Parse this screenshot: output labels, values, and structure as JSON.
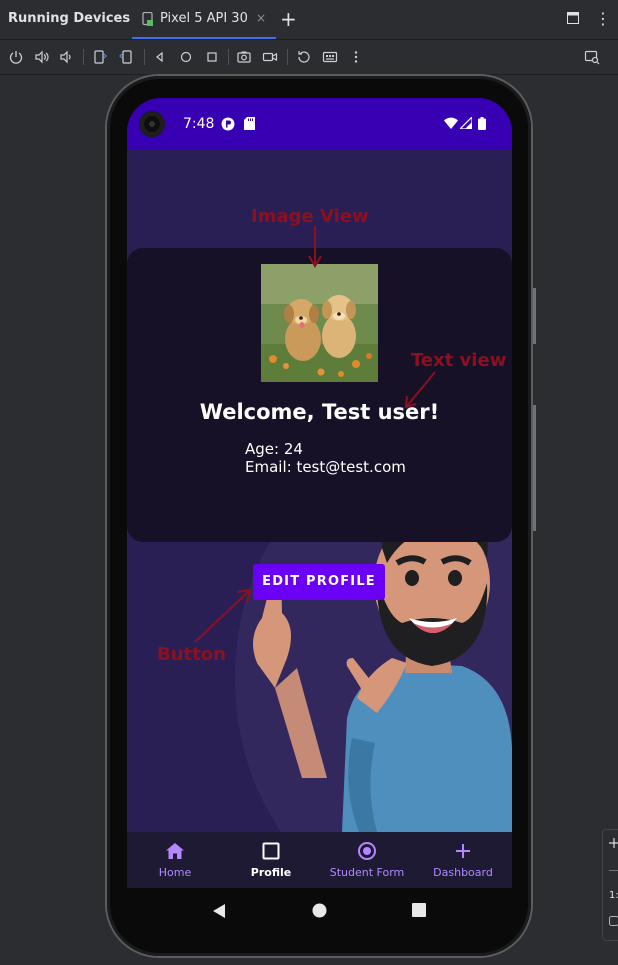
{
  "ide": {
    "window_title": "Running Devices",
    "tab_label": "Pixel 5 API 30",
    "tab_close": "×",
    "new_tab": "+",
    "more": "⋮",
    "panel_fragment_text": "1:"
  },
  "device": {
    "status_time": "7:48"
  },
  "app": {
    "welcome": "Welcome, Test user!",
    "age_line": "Age: 24",
    "email_line": "Email: test@test.com",
    "edit_button": "EDIT PROFILE",
    "annotations": {
      "image_view": "Image View",
      "text_view": "Text view",
      "button": "Button"
    },
    "nav": [
      {
        "label": "Home",
        "icon": "home-icon"
      },
      {
        "label": "Profile",
        "icon": "square-icon"
      },
      {
        "label": "Student Form",
        "icon": "radio-icon"
      },
      {
        "label": "Dashboard",
        "icon": "plus-icon"
      }
    ]
  },
  "colors": {
    "status_bar": "#3700b3",
    "app_background": "#2a1f55",
    "card": "#161126",
    "button": "#6a00f4",
    "nav_accent": "#b388ff",
    "annotation": "#8b1020",
    "ide_accent": "#3574f0"
  }
}
